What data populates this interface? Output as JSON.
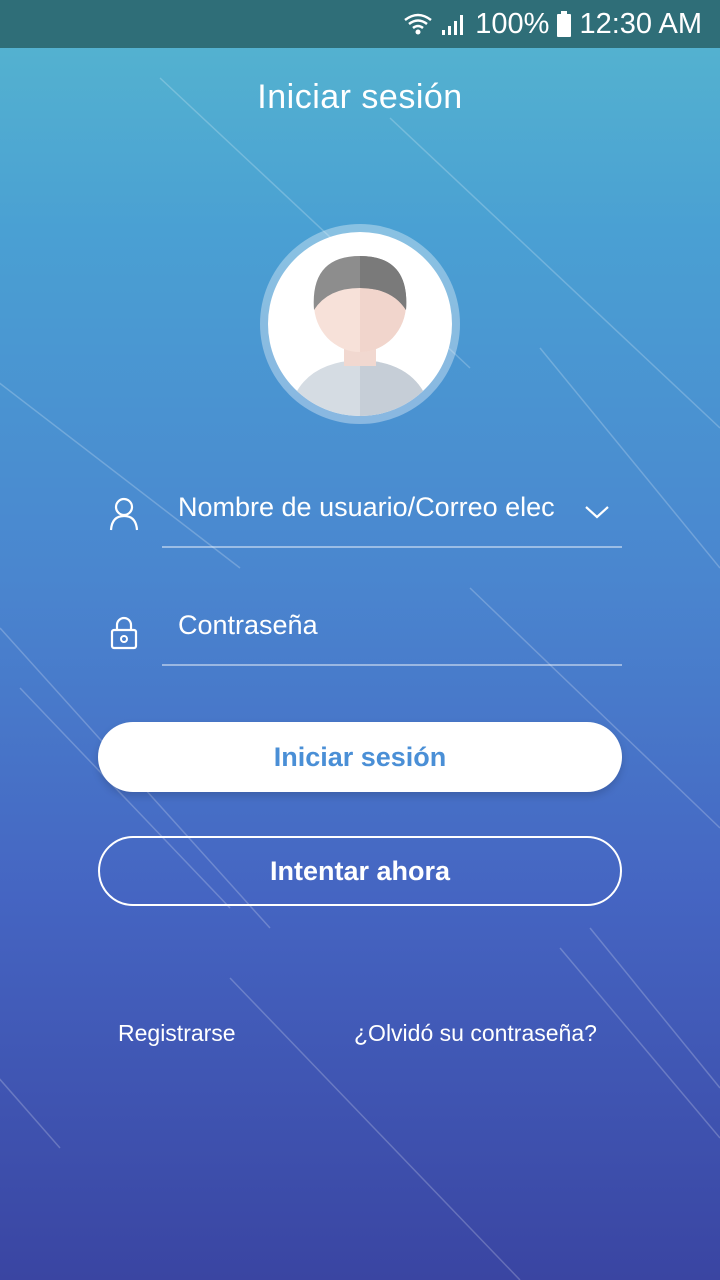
{
  "status_bar": {
    "battery": "100%",
    "time": "12:30 AM",
    "icons": [
      "wifi-icon",
      "signal-icon",
      "battery-icon"
    ]
  },
  "screen": {
    "title": "Iniciar sesión"
  },
  "form": {
    "username_placeholder": "Nombre de usuario/Correo electrónico",
    "username_display": "Nombre de usuario/Correo elec",
    "password_placeholder": "Contraseña",
    "icons": [
      "user-icon",
      "lock-icon",
      "chevron-down-icon"
    ]
  },
  "buttons": {
    "login": "Iniciar sesión",
    "try_now": "Intentar ahora"
  },
  "links": {
    "register": "Registrarse",
    "forgot_password": "¿Olvidó su contraseña?"
  },
  "colors": {
    "status_bar": "#2f6e78",
    "gradient_top": "#56b6cf",
    "gradient_bottom": "#3a45a2",
    "login_text": "#4a8fd6"
  }
}
